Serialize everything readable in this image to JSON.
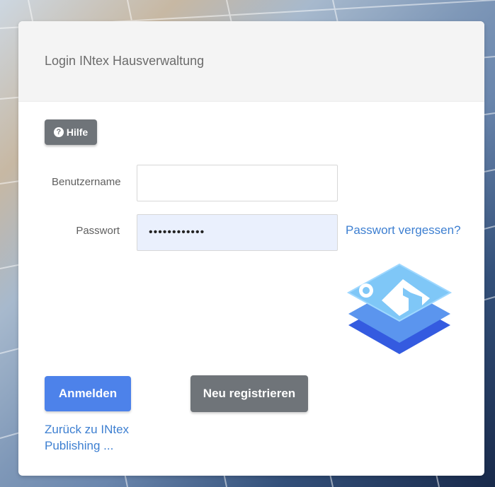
{
  "header": {
    "title": "Login INtex Hausverwaltung"
  },
  "help": {
    "label": "Hilfe",
    "icon": "question-circle-icon"
  },
  "form": {
    "username_label": "Benutzername",
    "username_value": "",
    "password_label": "Passwort",
    "password_value": "••••••••••••"
  },
  "links": {
    "forgot_password": "Passwort vergessen?",
    "back_to_publishing": "Zurück zu INtex Publishing ..."
  },
  "buttons": {
    "login": "Anmelden",
    "register": "Neu registrieren"
  },
  "colors": {
    "primary": "#4d82ea",
    "secondary": "#6f7479",
    "link": "#3d7fd1",
    "password_field_bg": "#eaf0fd",
    "logo_light": "#7fc7f7",
    "logo_mid": "#5b95ee",
    "logo_dark": "#345be0"
  },
  "logo": {
    "icon": "house-layers-logo"
  }
}
